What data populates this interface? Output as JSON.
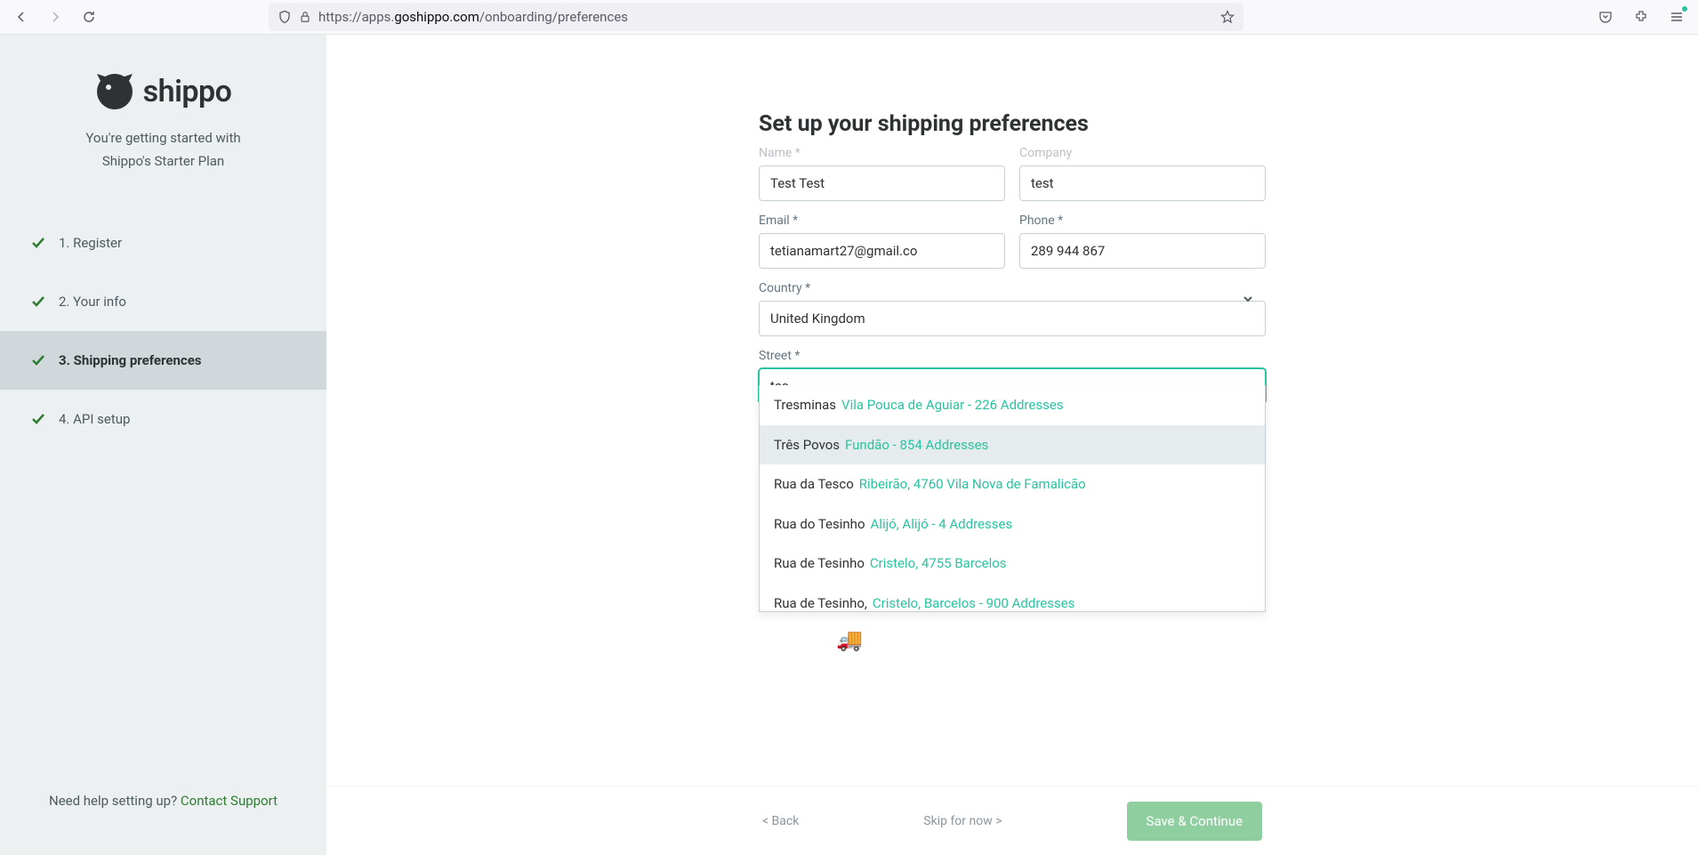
{
  "browser": {
    "url_prefix": "https://apps.",
    "url_domain": "goshippo.com",
    "url_path": "/onboarding/preferences"
  },
  "sidebar": {
    "logo_text": "shippo",
    "subtitle_line1": "You're getting started with",
    "subtitle_line2": "Shippo's Starter Plan",
    "steps": [
      {
        "label": "1. Register"
      },
      {
        "label": "2. Your info"
      },
      {
        "label": "3. Shipping preferences"
      },
      {
        "label": "4. API setup"
      }
    ],
    "help_prefix": "Need help setting up? ",
    "help_link": "Contact Support"
  },
  "form": {
    "title": "Set up your shipping preferences",
    "name_label": "Name *",
    "name_value": "Test Test",
    "company_label": "Company",
    "company_value": "test",
    "email_label": "Email *",
    "email_value": "tetianamart27@gmail.co",
    "phone_label": "Phone *",
    "phone_value": "289 944 867",
    "country_label": "Country *",
    "country_value": "United Kingdom",
    "street_label": "Street *",
    "street_value": "tes"
  },
  "autocomplete": [
    {
      "main": "Tresminas",
      "sub": "Vila Pouca de Aguiar - 226 Addresses"
    },
    {
      "main": "Três Povos",
      "sub": "Fundão - 854 Addresses"
    },
    {
      "main": "Rua da Tesco",
      "sub": "Ribeirão, 4760 Vila Nova de Famalicão"
    },
    {
      "main": "Rua do Tesinho",
      "sub": "Alijó, Alijó - 4 Addresses"
    },
    {
      "main": "Rua de Tesinho",
      "sub": "Cristelo, 4755 Barcelos"
    },
    {
      "main": "Rua de Tesinho,",
      "sub": "Cristelo, Barcelos - 900 Addresses"
    }
  ],
  "footer": {
    "back": "< Back",
    "skip": "Skip for now >",
    "save": "Save & Continue"
  }
}
